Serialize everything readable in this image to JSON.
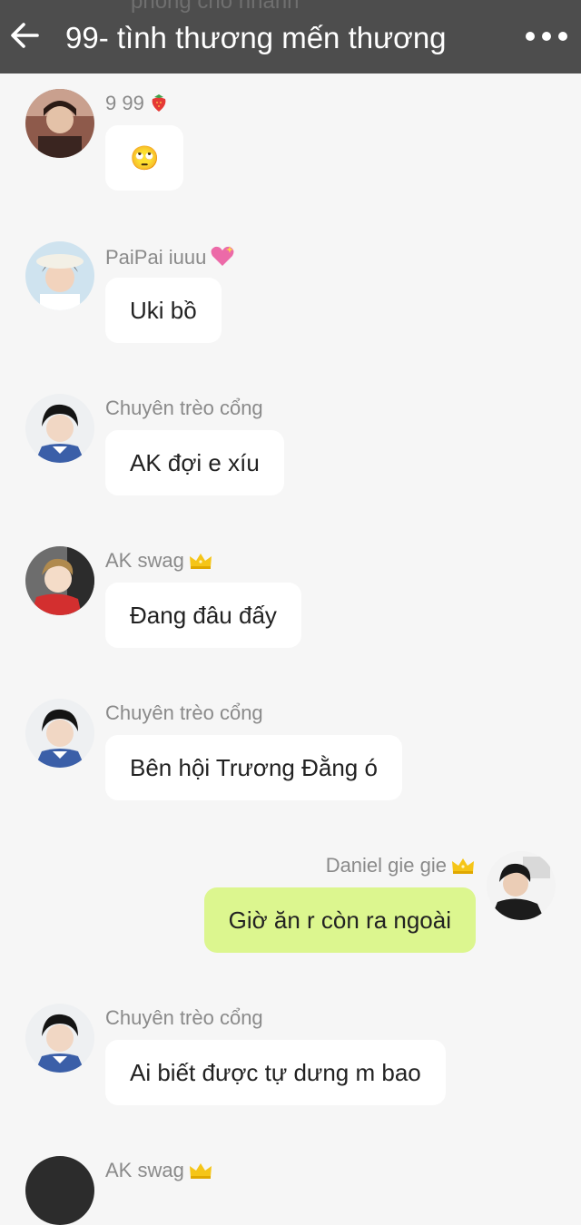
{
  "header": {
    "title": "99- tình thương mến thương",
    "ghost_text": "phong cho nhanh"
  },
  "messages": [
    {
      "sender": "9 99",
      "badge": "strawberry",
      "text": "🙄",
      "side": "left",
      "avatar": "avatar-9-99"
    },
    {
      "sender": "PaiPai iuuu",
      "badge": "heart",
      "text": "Uki bồ",
      "side": "left",
      "avatar": "avatar-paipai"
    },
    {
      "sender": "Chuyên trèo cổng",
      "badge": "",
      "text": "AK đợi e xíu",
      "side": "left",
      "avatar": "avatar-chuyen"
    },
    {
      "sender": "AK swag",
      "badge": "crown",
      "text": "Đang đâu đấy",
      "side": "left",
      "avatar": "avatar-ak"
    },
    {
      "sender": "Chuyên trèo cổng",
      "badge": "",
      "text": "Bên hội Trương Đằng ó",
      "side": "left",
      "avatar": "avatar-chuyen"
    },
    {
      "sender": "Daniel gie gie",
      "badge": "crown",
      "text": "Giờ ăn r còn ra ngoài",
      "side": "right",
      "avatar": "avatar-daniel"
    },
    {
      "sender": "Chuyên trèo cổng",
      "badge": "",
      "text": "Ai biết được tự dưng m bao",
      "side": "left",
      "avatar": "avatar-chuyen"
    }
  ],
  "partial_next": {
    "sender": "AK swag",
    "badge": "crown"
  },
  "icons": {
    "back": "back-arrow-icon",
    "more": "more-dots-icon",
    "strawberry": "strawberry-icon",
    "heart": "sparkling-heart-icon",
    "crown": "crown-icon"
  },
  "colors": {
    "header_bg": "#4d4d4d",
    "screen_bg": "#f6f6f6",
    "bubble_in": "#ffffff",
    "bubble_out": "#dcf68f",
    "sender_text": "#8a8a8a"
  }
}
